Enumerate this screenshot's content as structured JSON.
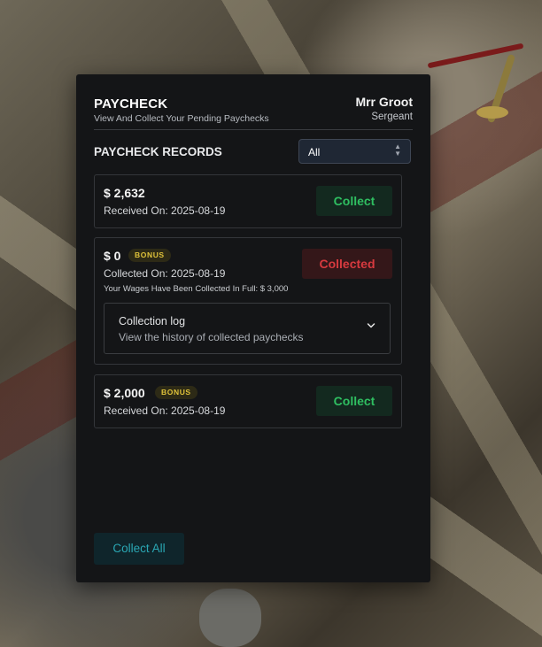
{
  "header": {
    "title": "PAYCHECK",
    "subtitle": "View And Collect Your Pending Paychecks",
    "user_name": "Mrr Groot",
    "user_rank": "Sergeant"
  },
  "records": {
    "label": "PAYCHECK RECORDS",
    "filter": {
      "selected": "All"
    }
  },
  "paychecks": [
    {
      "amount": "$ 2,632",
      "date": "Received On: 2025-08-19",
      "button": "Collect",
      "status": "pending"
    },
    {
      "amount": "$ 0",
      "badge": "BONUS",
      "date": "Collected On: 2025-08-19",
      "note": "Your Wages Have Been Collected In Full: $ 3,000",
      "button": "Collected",
      "status": "collected",
      "log": {
        "title": "Collection log",
        "description": "View the history of collected paychecks"
      }
    },
    {
      "amount": "$ 2,000",
      "badge": "BONUS",
      "date": "Received On: 2025-08-19",
      "button": "Collect",
      "status": "pending"
    }
  ],
  "footer": {
    "collect_all_label": "Collect All"
  },
  "colors": {
    "panel_bg": "#141517",
    "collect_green": "#2fbf61",
    "collected_red": "#d73a3f",
    "bonus_yellow": "#e0c33a",
    "collect_all_teal": "#2aa7b4"
  }
}
